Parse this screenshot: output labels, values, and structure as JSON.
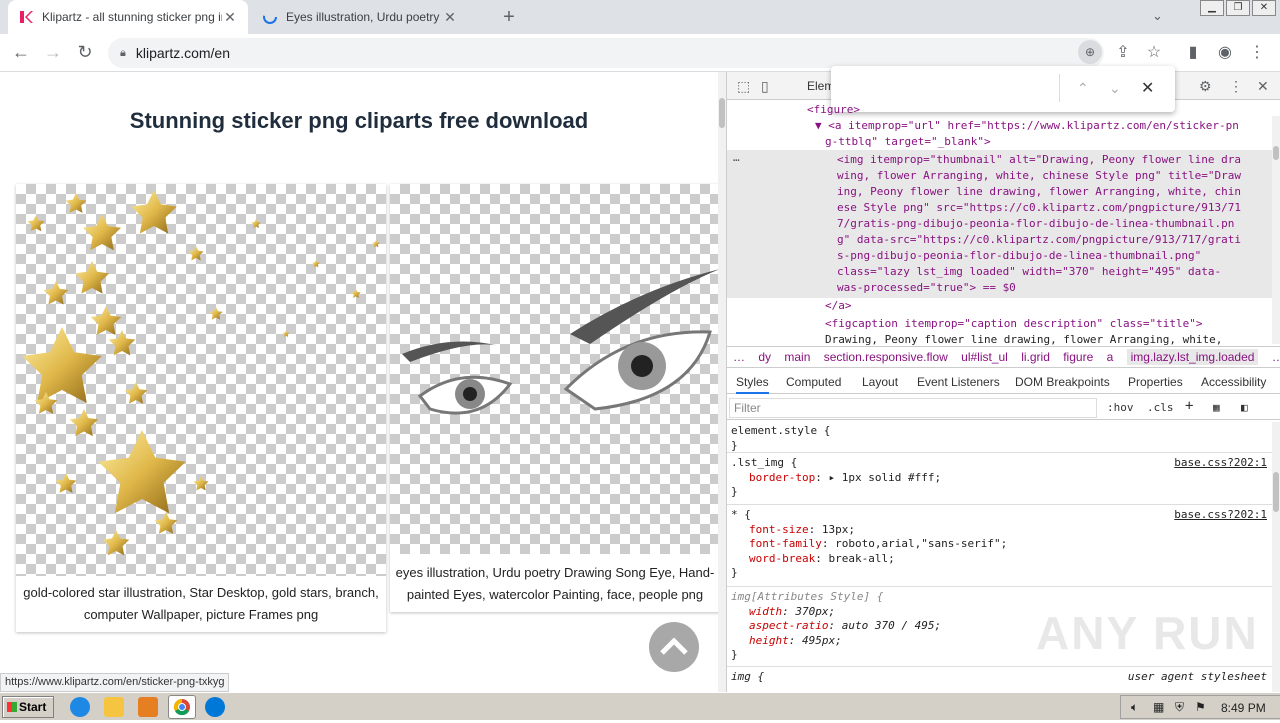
{
  "browser": {
    "tabs": [
      {
        "title": "Klipartz - all stunning sticker png ima",
        "close": "✕",
        "active": true
      },
      {
        "title": "Eyes illustration, Urdu poetry Drawin",
        "close": "✕",
        "active": false
      }
    ],
    "new_tab": "+",
    "tab_dropdown": "⌄",
    "window_controls": [
      "▁",
      "❐",
      "✕"
    ],
    "nav": {
      "back": "←",
      "forward": "→",
      "reload": "↻"
    },
    "address": "klipartz.com/en",
    "status_url": "https://www.klipartz.com/en/sticker-png-txkyg"
  },
  "page": {
    "heading": "Stunning sticker png cliparts free download",
    "cards": [
      {
        "caption": "gold-colored star illustration, Star Desktop, gold stars, branch, computer Wallpaper, picture Frames png"
      },
      {
        "caption": "eyes illustration, Urdu poetry Drawing Song Eye, Hand-painted Eyes, watercolor Painting, face, people png"
      }
    ],
    "scroll_top_icon": "chevron-up"
  },
  "devtools": {
    "tab_elements": "Elem",
    "dom_lines": [
      {
        "text": "<figure>"
      },
      {
        "text": "▼ <a itemprop=\"url\" href=\"https://www.klipartz.com/en/sticker-pn"
      },
      {
        "text": "g-ttblq\" target=\"_blank\">"
      },
      {
        "text": "<img itemprop=\"thumbnail\" alt=\"Drawing, Peony flower line dra"
      },
      {
        "text": "wing, flower Arranging, white, chinese Style png\" title=\"Draw"
      },
      {
        "text": "ing, Peony flower line drawing, flower Arranging, white, chin"
      },
      {
        "text": "ese Style png\" src=\"https://c0.klipartz.com/pngpicture/913/71"
      },
      {
        "text": "7/gratis-png-dibujo-peonia-flor-dibujo-de-linea-thumbnail.pn"
      },
      {
        "text": "g\" data-src=\"https://c0.klipartz.com/pngpicture/913/717/grati"
      },
      {
        "text": "s-png-dibujo-peonia-flor-dibujo-de-linea-thumbnail.png\""
      },
      {
        "text": "class=\"lazy lst_img loaded\" width=\"370\" height=\"495\" data-"
      },
      {
        "text": "was-processed=\"true\"> == $0"
      },
      {
        "text": "</a>"
      },
      {
        "text": "<figcaption itemprop=\"caption description\" class=\"title\">"
      },
      {
        "text": "Drawing, Peony flower line drawing, flower Arranging, white,"
      }
    ],
    "ellipsis": "…",
    "breadcrumbs": [
      "…",
      "dy",
      "main",
      "section.responsive.flow",
      "ul#list_ul",
      "li.grid",
      "figure",
      "a",
      "img.lazy.lst_img.loaded",
      "…"
    ],
    "pane_tabs": [
      "Styles",
      "Computed",
      "Layout",
      "Event Listeners",
      "DOM Breakpoints",
      "Properties",
      "Accessibility"
    ],
    "filter_placeholder": "Filter",
    "filter_hov": ":hov",
    "filter_cls": ".cls",
    "filter_plus": "+",
    "rules": [
      {
        "selector": "element.style {",
        "source": "",
        "props": [],
        "close": "}"
      },
      {
        "selector": ".lst_img {",
        "source": "base.css?202:1",
        "props": [
          {
            "name": "border-top",
            "value": ": ▸ 1px solid  #fff;"
          }
        ],
        "close": "}"
      },
      {
        "selector": "* {",
        "source": "base.css?202:1",
        "props": [
          {
            "name": "font-size",
            "value": ": 13px;"
          },
          {
            "name": "font-family",
            "value": ": roboto,arial,\"sans-serif\";"
          },
          {
            "name": "word-break",
            "value": ": break-all;"
          }
        ],
        "close": "}"
      },
      {
        "selector": "img[Attributes Style] {",
        "source": "",
        "props": [
          {
            "name": "width",
            "value": ": 370px;"
          },
          {
            "name": "aspect-ratio",
            "value": ": auto 370 / 495;"
          },
          {
            "name": "height",
            "value": ": 495px;"
          }
        ],
        "close": "}"
      },
      {
        "selector": "img {",
        "source": "user agent stylesheet",
        "props": [],
        "close": ""
      }
    ]
  },
  "taskbar": {
    "start": "Start",
    "clock": "8:49 PM"
  },
  "watermark": "ANY RUN"
}
